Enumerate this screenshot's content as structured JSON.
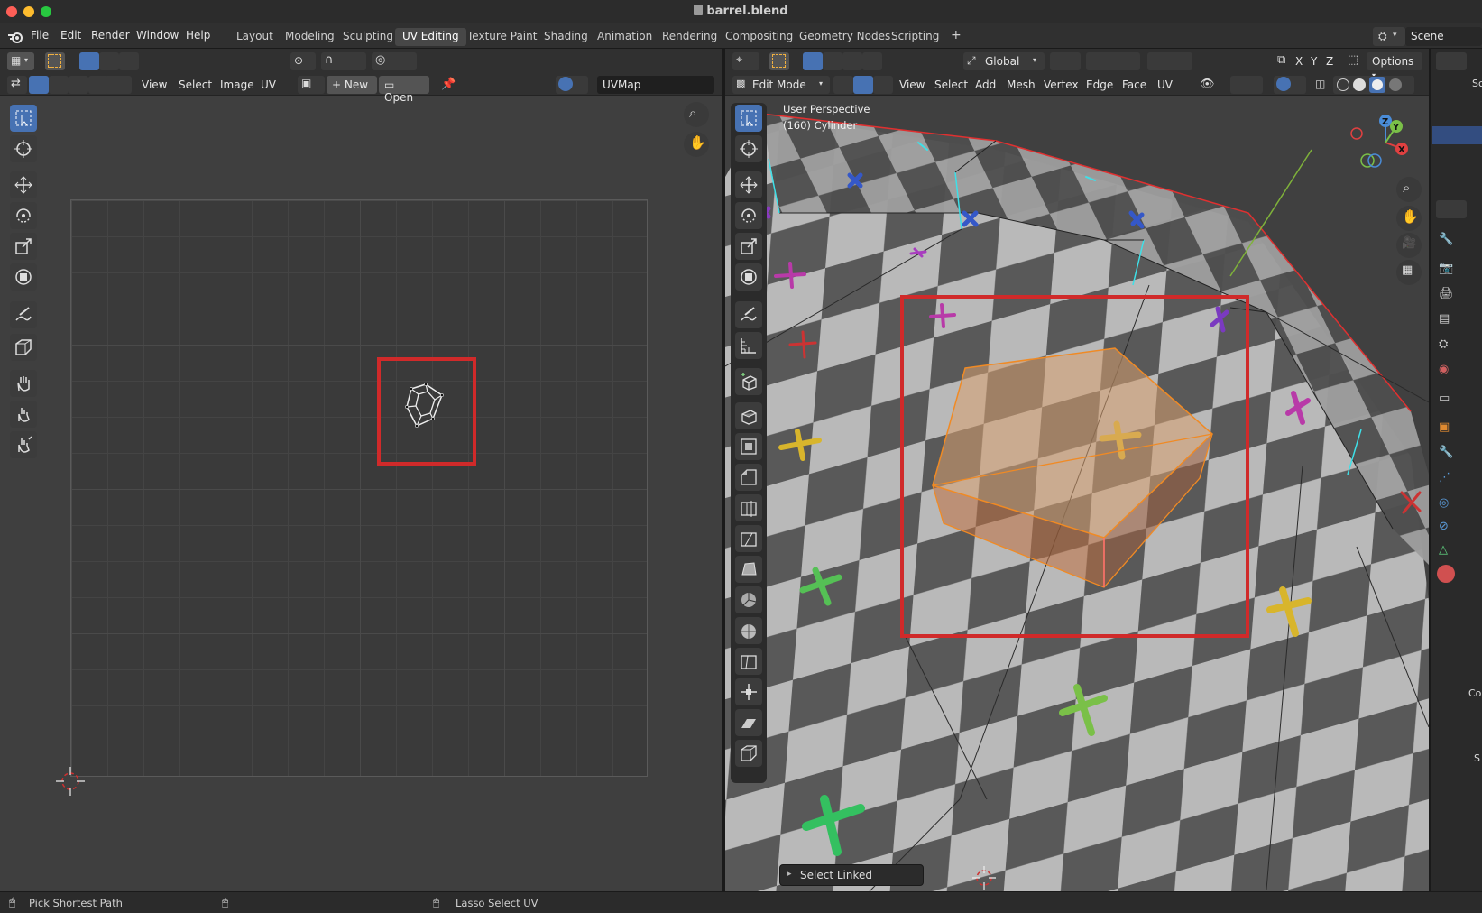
{
  "window": {
    "title": "barrel.blend"
  },
  "menubar": {
    "items": [
      "File",
      "Edit",
      "Render",
      "Window",
      "Help"
    ]
  },
  "workspaces": {
    "tabs": [
      "Layout",
      "Modeling",
      "Sculpting",
      "UV Editing",
      "Texture Paint",
      "Shading",
      "Animation",
      "Rendering",
      "Compositing",
      "Geometry Nodes",
      "Scripting"
    ],
    "active": "UV Editing",
    "add_label": "+"
  },
  "scene": {
    "name": "Scene"
  },
  "uv_editor": {
    "menus": [
      "View",
      "Select",
      "Image",
      "UV"
    ],
    "new_label": "New",
    "open_label": "Open",
    "uvmap": "UVMap"
  },
  "viewport": {
    "header": {
      "orientation": "Global",
      "options_label": "Options",
      "mode": "Edit Mode",
      "menus": [
        "View",
        "Select",
        "Add",
        "Mesh",
        "Vertex",
        "Edge",
        "Face",
        "UV"
      ]
    },
    "overlay_text": [
      "User Perspective",
      "(160) Cylinder"
    ],
    "gizmo_axes": [
      "Z",
      "Y",
      "X"
    ],
    "axis_toggles": [
      "X",
      "Y",
      "Z"
    ],
    "last_operator": "Select Linked"
  },
  "right_panel": {
    "partial_labels": [
      "Sc",
      "Col",
      "S"
    ]
  },
  "statusbar": {
    "left": "Pick Shortest Path",
    "middle": "Lasso Select UV"
  },
  "colors": {
    "highlight_box": "#d02a2a",
    "selection_orange": "#f08a24",
    "active_blue": "#4772b3"
  }
}
